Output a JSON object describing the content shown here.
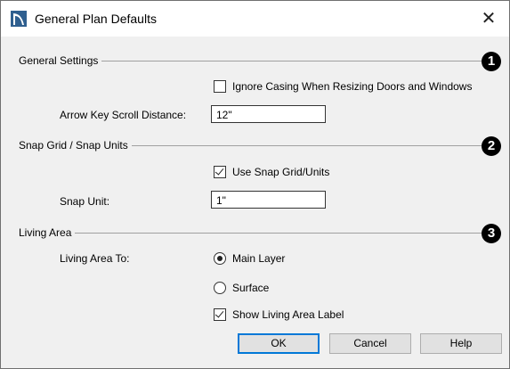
{
  "window": {
    "title": "General Plan Defaults",
    "close_glyph": "✕"
  },
  "sections": {
    "general_settings": {
      "title": "General Settings",
      "badge": "1",
      "ignore_casing": {
        "label": "Ignore Casing When Resizing Doors and Windows",
        "checked": false
      },
      "arrow_key": {
        "label": "Arrow Key Scroll Distance:",
        "value": "12\""
      }
    },
    "snap_grid": {
      "title": "Snap Grid / Snap Units",
      "badge": "2",
      "use_snap": {
        "label": "Use Snap Grid/Units",
        "checked": true
      },
      "snap_unit": {
        "label": "Snap Unit:",
        "value": "1\""
      }
    },
    "living_area": {
      "title": "Living Area",
      "badge": "3",
      "living_area_to": {
        "label": "Living Area To:"
      },
      "options": [
        {
          "label": "Main Layer",
          "selected": true
        },
        {
          "label": "Surface",
          "selected": false
        }
      ],
      "show_label": {
        "label": "Show Living Area Label",
        "checked": true
      }
    }
  },
  "buttons": {
    "ok": "OK",
    "cancel": "Cancel",
    "help": "Help"
  },
  "icons": {
    "app": "chief-architect-icon",
    "close": "close-icon"
  },
  "colors": {
    "accent": "#0078d7",
    "badge": "#000000",
    "app_icon": "#2f5f8f"
  }
}
